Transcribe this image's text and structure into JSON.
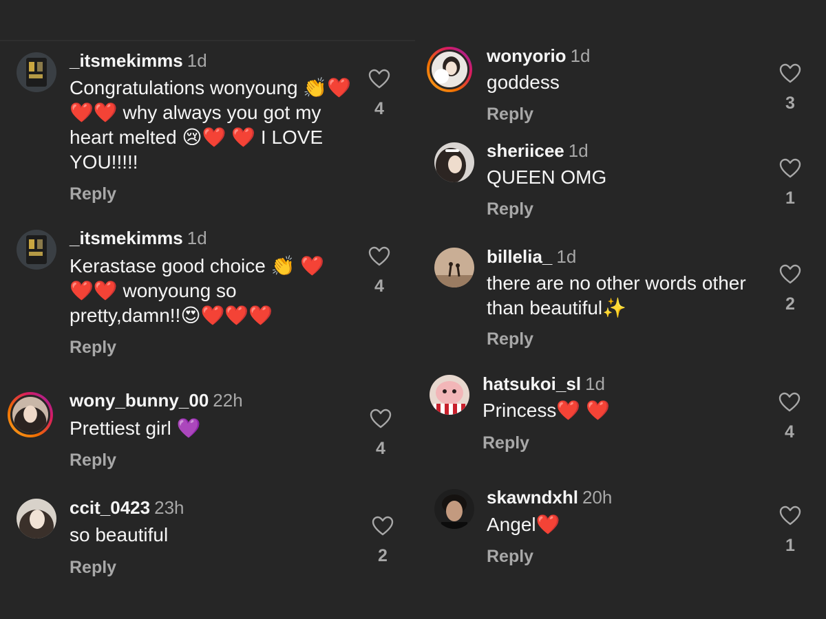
{
  "left_comments": [
    {
      "username": "_itsmekimms",
      "time": "1d",
      "text": "Congratulations wonyoung 👏❤️❤️❤️ why always you got my heart melted 😢❤️ ❤️ I LOVE YOU!!!!!",
      "reply": "Reply",
      "likes": "4"
    },
    {
      "username": "_itsmekimms",
      "time": "1d",
      "text": "Kerastase good choice 👏 ❤️❤️❤️ wonyoung so pretty,damn!!😍❤️❤️❤️",
      "reply": "Reply",
      "likes": "4"
    },
    {
      "username": "wony_bunny_00",
      "time": "22h",
      "text": "Prettiest girl 💜",
      "reply": "Reply",
      "likes": "4"
    },
    {
      "username": "ccit_0423",
      "time": "23h",
      "text": "so beautiful",
      "reply": "Reply",
      "likes": "2"
    }
  ],
  "right_comments": [
    {
      "username": "wonyorio",
      "time": "1d",
      "text": "goddess",
      "reply": "Reply",
      "likes": "3"
    },
    {
      "username": "sheriicee",
      "time": "1d",
      "text": "QUEEN OMG",
      "reply": "Reply",
      "likes": "1"
    },
    {
      "username": "billelia_",
      "time": "1d",
      "text": "there are no other words other than beautiful✨",
      "reply": "Reply",
      "likes": "2"
    },
    {
      "username": "hatsukoi_sl",
      "time": "1d",
      "text": "Princess❤️ ❤️",
      "reply": "Reply",
      "likes": "4"
    },
    {
      "username": "skawndxhl",
      "time": "20h",
      "text": "Angel❤️",
      "reply": "Reply",
      "likes": "1"
    }
  ],
  "icons": {
    "like": "heart-outline-icon"
  },
  "colors": {
    "background": "#262626",
    "text": "#f5f5f5",
    "muted": "#a8a8a8"
  }
}
